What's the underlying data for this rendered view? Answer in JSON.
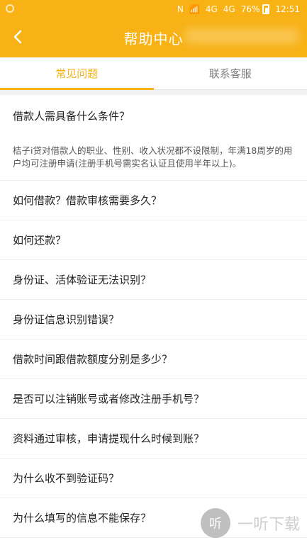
{
  "status": {
    "left_icon": "circle-icon",
    "battery_percent": "76%",
    "time": "12:51",
    "signals": [
      "N",
      "wifi",
      "4G",
      "4G"
    ]
  },
  "header": {
    "title": "帮助中心",
    "back_icon": "chevron-left-icon"
  },
  "tabs": [
    {
      "label": "常见问题",
      "active": true
    },
    {
      "label": "联系客服",
      "active": false
    }
  ],
  "faq": [
    {
      "question": "借款人需具备什么条件？",
      "answer": "桔子i贷对借款人的职业、性别、收入状况都不设限制，年满18周岁的用户均可注册申请(注册手机号需实名认证且使用半年以上)。"
    },
    {
      "question": "如何借款？借款审核需要多久？",
      "answer": ""
    },
    {
      "question": "如何还款？",
      "answer": ""
    },
    {
      "question": "身份证、活体验证无法识别？",
      "answer": ""
    },
    {
      "question": "身份证信息识别错误？",
      "answer": ""
    },
    {
      "question": "借款时间跟借款额度分别是多少？",
      "answer": ""
    },
    {
      "question": "是否可以注销账号或者修改注册手机号？",
      "answer": ""
    },
    {
      "question": "资料通过审核，申请提现什么时候到账？",
      "answer": ""
    },
    {
      "question": "为什么收不到验证码？",
      "answer": ""
    },
    {
      "question": "为什么填写的信息不能保存？",
      "answer": ""
    }
  ],
  "watermark": {
    "logo_char": "听",
    "text": "一听下载"
  },
  "colors": {
    "accent": "#f8b216",
    "text": "#222222",
    "muted": "#7f7f7f"
  }
}
